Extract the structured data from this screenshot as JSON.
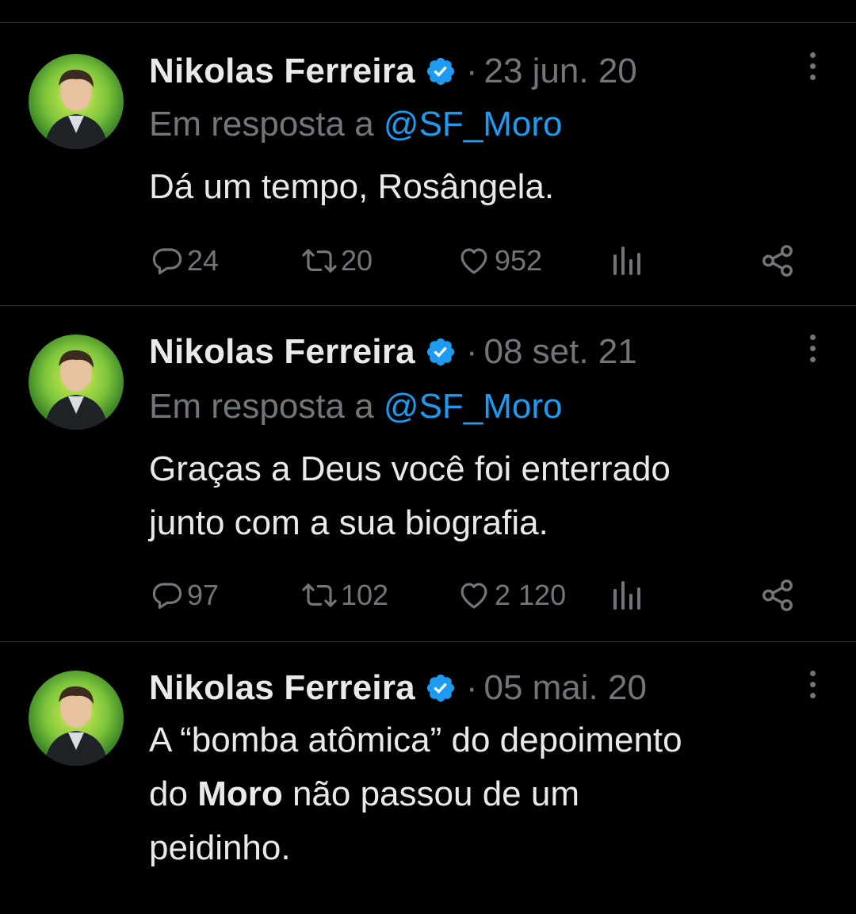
{
  "colors": {
    "background": "#000000",
    "text": "#e7e9ea",
    "muted": "#71767b",
    "link": "#1d9bf0",
    "verified": "#1d9bf0",
    "divider": "#2f3336"
  },
  "icons": {
    "reply": "reply-icon",
    "retweet": "retweet-icon",
    "like": "heart-icon",
    "views": "views-icon",
    "share": "share-icon",
    "more": "more-icon",
    "verified": "verified-badge-icon"
  },
  "tweets": [
    {
      "author": "Nikolas Ferreira",
      "separator": "·",
      "date": "23 jun. 20",
      "reply_prefix": "Em resposta a",
      "reply_handle": "@SF_Moro",
      "text": "Dá um tempo, Rosângela.",
      "replies": "24",
      "retweets": "20",
      "likes": "952"
    },
    {
      "author": "Nikolas Ferreira",
      "separator": "·",
      "date": "08 set. 21",
      "reply_prefix": "Em resposta a",
      "reply_handle": "@SF_Moro",
      "text_line1": "Graças a Deus você foi enterrado",
      "text_line2": "junto com a sua biografia.",
      "replies": "97",
      "retweets": "102",
      "likes": "2 120"
    },
    {
      "author": "Nikolas Ferreira",
      "separator": "·",
      "date": "05 mai. 20",
      "text_line1": "A “bomba atômica” do depoimento",
      "text_line2_pre": "do",
      "text_line2_bold": "Moro",
      "text_line2_post": "não passou de um",
      "text_line3": "peidinho."
    }
  ]
}
